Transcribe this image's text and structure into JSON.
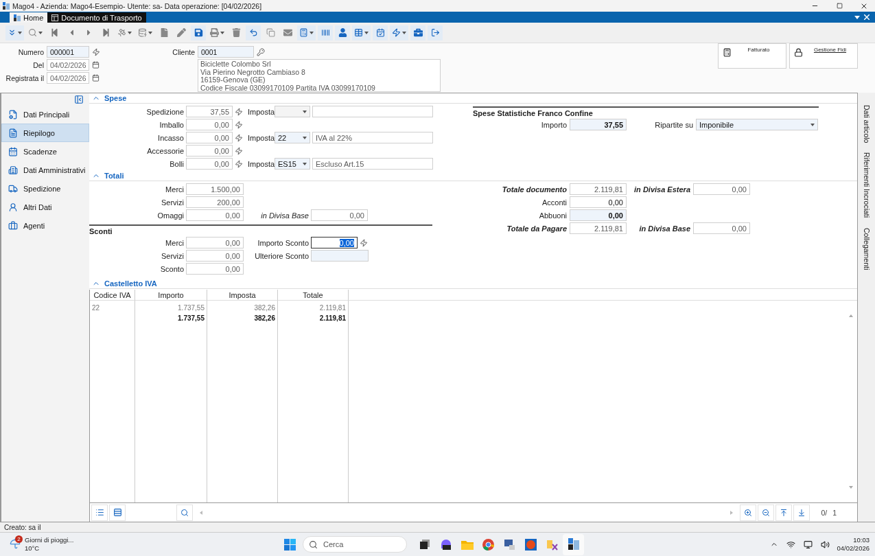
{
  "title_bar": {
    "title": "Mago4 - Azienda: Mago4-Esempio- Utente: sa- Data operazione: [04/02/2026]"
  },
  "tabs": [
    {
      "label": "Home",
      "selected": false
    },
    {
      "label": "Documento di Trasporto",
      "selected": true
    }
  ],
  "header": {
    "numero": {
      "label": "Numero",
      "value": "000001"
    },
    "del": {
      "label": "Del",
      "value": "04/02/2026"
    },
    "registrata": {
      "label": "Registrata il",
      "value": "04/02/2026"
    },
    "cliente": {
      "label": "Cliente",
      "value": "0001"
    },
    "address": [
      "Biciclette Colombo Srl",
      "Via Pierino Negrotto Cambiaso 8",
      "16159-Genova (GE)",
      "Codice Fiscale 03099170109 Partita IVA 03099170109"
    ],
    "widgets": [
      {
        "label": "Fatturato",
        "link": false
      },
      {
        "label": "Gestione Fidi",
        "link": true
      }
    ]
  },
  "side_tabs": [
    "Dati articolo",
    "Riferimenti Incrociati",
    "Collegamenti"
  ],
  "sidebar": {
    "items": [
      {
        "label": "Dati Principali",
        "selected": false
      },
      {
        "label": "Riepilogo",
        "selected": true
      },
      {
        "label": "Scadenze",
        "selected": false
      },
      {
        "label": "Dati Amministrativi",
        "selected": false
      },
      {
        "label": "Spedizione",
        "selected": false
      },
      {
        "label": "Altri Dati",
        "selected": false
      },
      {
        "label": "Agenti",
        "selected": false
      }
    ]
  },
  "spese": {
    "title": "Spese",
    "expanded": true,
    "rows": [
      {
        "label": "Spedizione",
        "value": "37,55",
        "imposta": {
          "label": "Imposta",
          "disabled": true
        }
      },
      {
        "label": "Imballo",
        "value": "0,00"
      },
      {
        "label": "Incasso",
        "value": "0,00",
        "imposta": {
          "label": "Imposta",
          "code": "22",
          "description": "IVA al 22%",
          "disabled": false
        }
      },
      {
        "label": "Accessorie",
        "value": "0,00"
      },
      {
        "label": "Bolli",
        "value": "0,00",
        "imposta": {
          "label": "Imposta",
          "code": "ES15",
          "description": "Escluso Art.15",
          "disabled": false
        }
      }
    ]
  },
  "statistiche": {
    "title": "Spese Statistiche Franco Confine",
    "importo": {
      "label": "Importo",
      "value": "37,55"
    },
    "ripartite": {
      "label": "Ripartite su",
      "value": "Imponibile"
    }
  },
  "totali": {
    "title": "Totali",
    "expanded": true,
    "left": [
      {
        "label": "Merci",
        "value": "1.500,00"
      },
      {
        "label": "Servizi",
        "value": "200,00"
      },
      {
        "label": "Omaggi",
        "value": "0,00"
      }
    ],
    "divisa_base": {
      "label": "in Divisa Base",
      "value": "0,00"
    },
    "right": [
      {
        "label": "Totale documento",
        "value": "2.119,81",
        "kind": "readonly",
        "emphasis": true,
        "extra": {
          "label": "in Divisa Estera",
          "value": "0,00"
        }
      },
      {
        "label": "Acconti",
        "value": "0,00",
        "kind": "input",
        "emphasis": false
      },
      {
        "label": "Abbuoni",
        "value": "0,00",
        "kind": "highlight",
        "emphasis": false
      },
      {
        "label": "Totale da Pagare",
        "value": "2.119,81",
        "kind": "readonly",
        "emphasis": true,
        "extra": {
          "label": "in Divisa Base",
          "value": "0,00"
        }
      }
    ]
  },
  "sconti": {
    "title": "Sconti",
    "rows": [
      {
        "label": "Merci",
        "value": "0,00"
      },
      {
        "label": "Servizi",
        "value": "0,00"
      },
      {
        "label": "Sconto",
        "value": "0,00"
      }
    ],
    "importo_sconto": {
      "label": "Importo Sconto",
      "value": "0,00",
      "focused": true
    },
    "ulteriore": {
      "label": "Ulteriore Sconto"
    }
  },
  "castelletto": {
    "title": "Castelletto IVA",
    "expanded": true,
    "columns": [
      "Codice IVA",
      "Importo",
      "Imposta",
      "Totale"
    ],
    "rows": [
      [
        "22",
        "1.737,55",
        "382,26",
        "2.119,81"
      ]
    ],
    "total": [
      "1.737,55",
      "382,26",
      "2.119,81"
    ]
  },
  "pager": {
    "current": "0/",
    "total": "1"
  },
  "status_bar": {
    "text": "Creato: sa il"
  },
  "taskbar": {
    "weather": {
      "badge": "2",
      "title": "Giorni di pioggi...",
      "temp": "10°C"
    },
    "search": {
      "placeholder": "Cerca"
    },
    "time": "10:03",
    "date": "04/02/2026"
  }
}
